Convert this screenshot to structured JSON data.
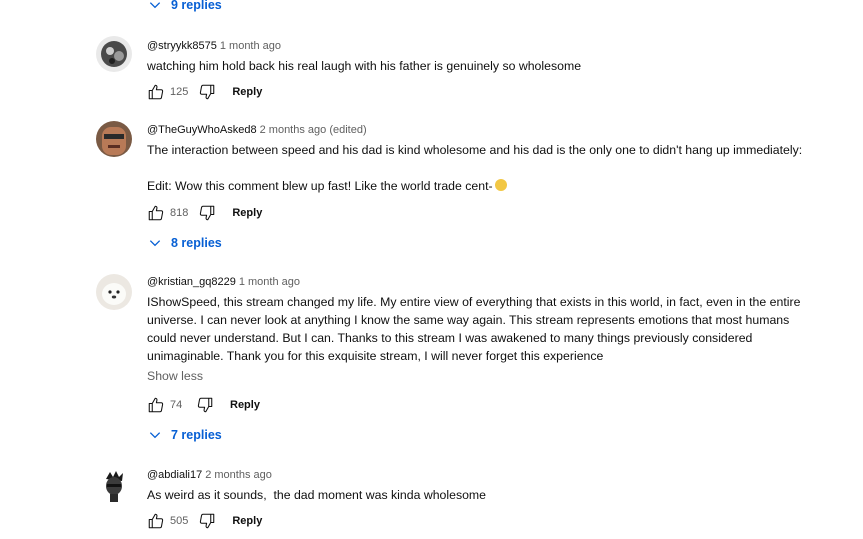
{
  "top_replies": {
    "label": "9 replies"
  },
  "comments": [
    {
      "handle": "@stryykk8575",
      "time": "1 month ago",
      "text": [
        "watching him hold back his real laugh with his father is genuinely so wholesome"
      ],
      "likes": "125",
      "reply_label": "Reply"
    },
    {
      "handle": "@TheGuyWhoAsked8",
      "time": "2 months ago (edited)",
      "text": [
        "The interaction between speed and his dad is kind wholesome and his dad is the only one to didn't hang up immediately:",
        "Edit: Wow this comment blew up fast! Like the world trade cent-"
      ],
      "likes": "818",
      "reply_label": "Reply",
      "replies_label": "8 replies"
    },
    {
      "handle": "@kristian_gq8229",
      "time": "1 month ago",
      "text": [
        "IShowSpeed, this stream changed my life. My entire view of everything that exists in this world, in fact, even in the entire universe. I can never look at anything I know the same way again. This stream represents emotions that most humans could never understand. But I can. Thanks to this stream I was awakened to many things previously considered unimaginable. Thank you for this exquisite stream, I will never forget this experience"
      ],
      "show_less": "Show less",
      "likes": "74",
      "reply_label": "Reply",
      "replies_label": "7 replies"
    },
    {
      "handle": "@abdiali17",
      "time": "2 months ago",
      "text": [
        "As weird as it sounds,  the dad moment was kinda wholesome"
      ],
      "likes": "505",
      "reply_label": "Reply"
    }
  ],
  "icons": {
    "like": "thumb-up-icon",
    "dislike": "thumb-down-icon",
    "expand": "chevron-down-icon",
    "emoji": "face-emoji-icon"
  },
  "colors": {
    "link_blue": "#065fd4",
    "meta_gray": "#606060",
    "text": "#0f0f0f"
  }
}
